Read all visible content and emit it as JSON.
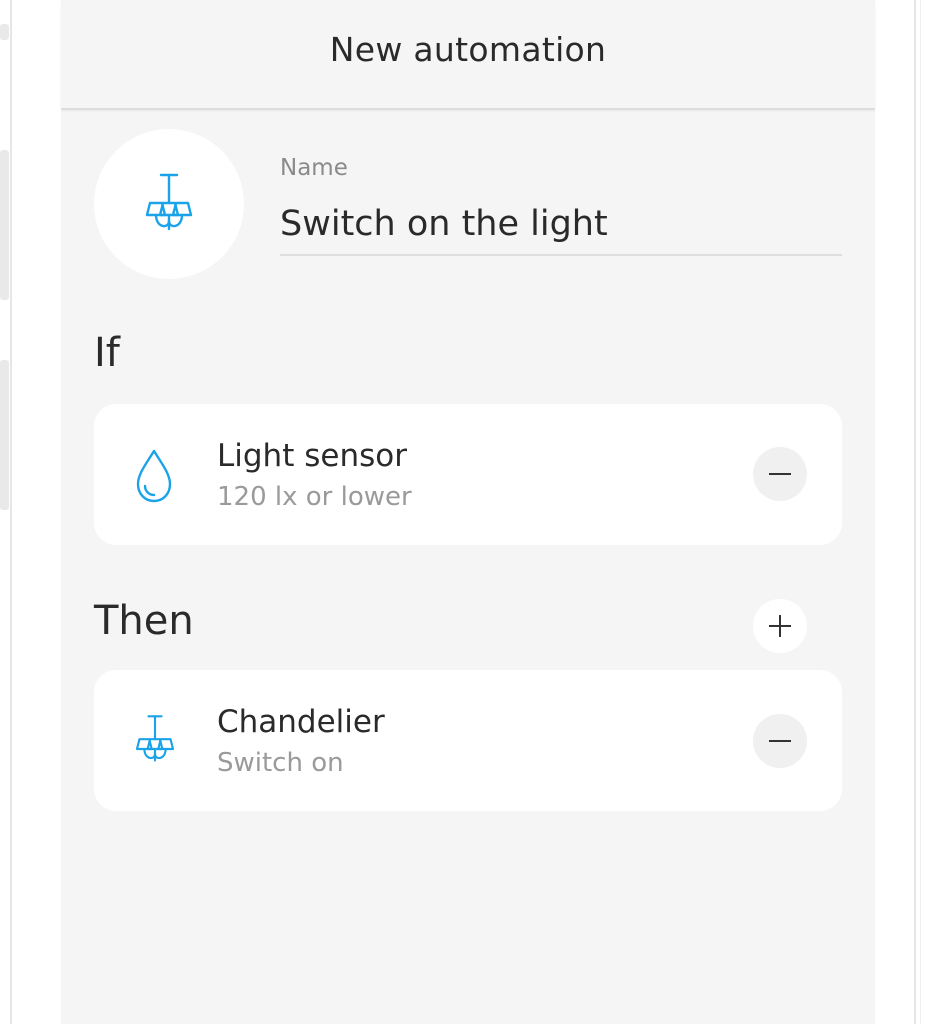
{
  "header": {
    "title": "New automation"
  },
  "automation": {
    "icon": "chandelier-icon",
    "name_label": "Name",
    "name_value": "Switch on the light"
  },
  "if_section": {
    "title": "If",
    "items": [
      {
        "icon": "water-drop-icon",
        "title": "Light sensor",
        "subtitle": "120 lx or lower"
      }
    ]
  },
  "then_section": {
    "title": "Then",
    "items": [
      {
        "icon": "chandelier-icon",
        "title": "Chandelier",
        "subtitle": "Switch on"
      }
    ]
  },
  "colors": {
    "accent": "#1aa3e8",
    "background": "#f5f5f5",
    "card": "#ffffff"
  }
}
